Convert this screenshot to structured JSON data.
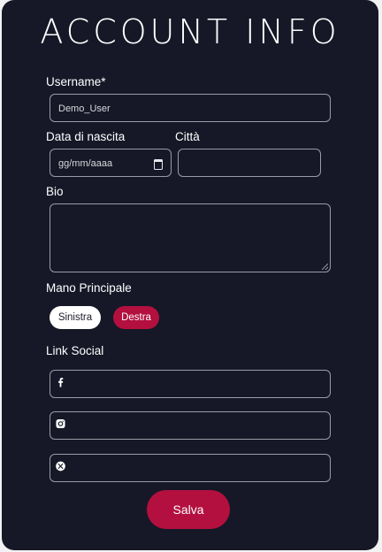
{
  "form": {
    "title": "ACCOUNT INFO",
    "username": {
      "label": "Username*",
      "value": "Demo_User"
    },
    "birth_date": {
      "label": "Data di nascita",
      "placeholder": "gg/mm/aaaa"
    },
    "city": {
      "label": "Città",
      "value": ""
    },
    "bio": {
      "label": "Bio",
      "value": ""
    },
    "handedness": {
      "label": "Mano Principale",
      "options": [
        "Sinistra",
        "Destra"
      ],
      "selected": "Destra"
    },
    "social": {
      "label": "Link Social",
      "links": [
        {
          "icon": "facebook-icon",
          "value": ""
        },
        {
          "icon": "instagram-icon",
          "value": ""
        },
        {
          "icon": "x-icon",
          "value": ""
        }
      ]
    },
    "save_label": "Salva"
  },
  "colors": {
    "background": "#161827",
    "accent": "#b3103f",
    "field_border": "#9a9ba6",
    "text": "#ffffff"
  }
}
